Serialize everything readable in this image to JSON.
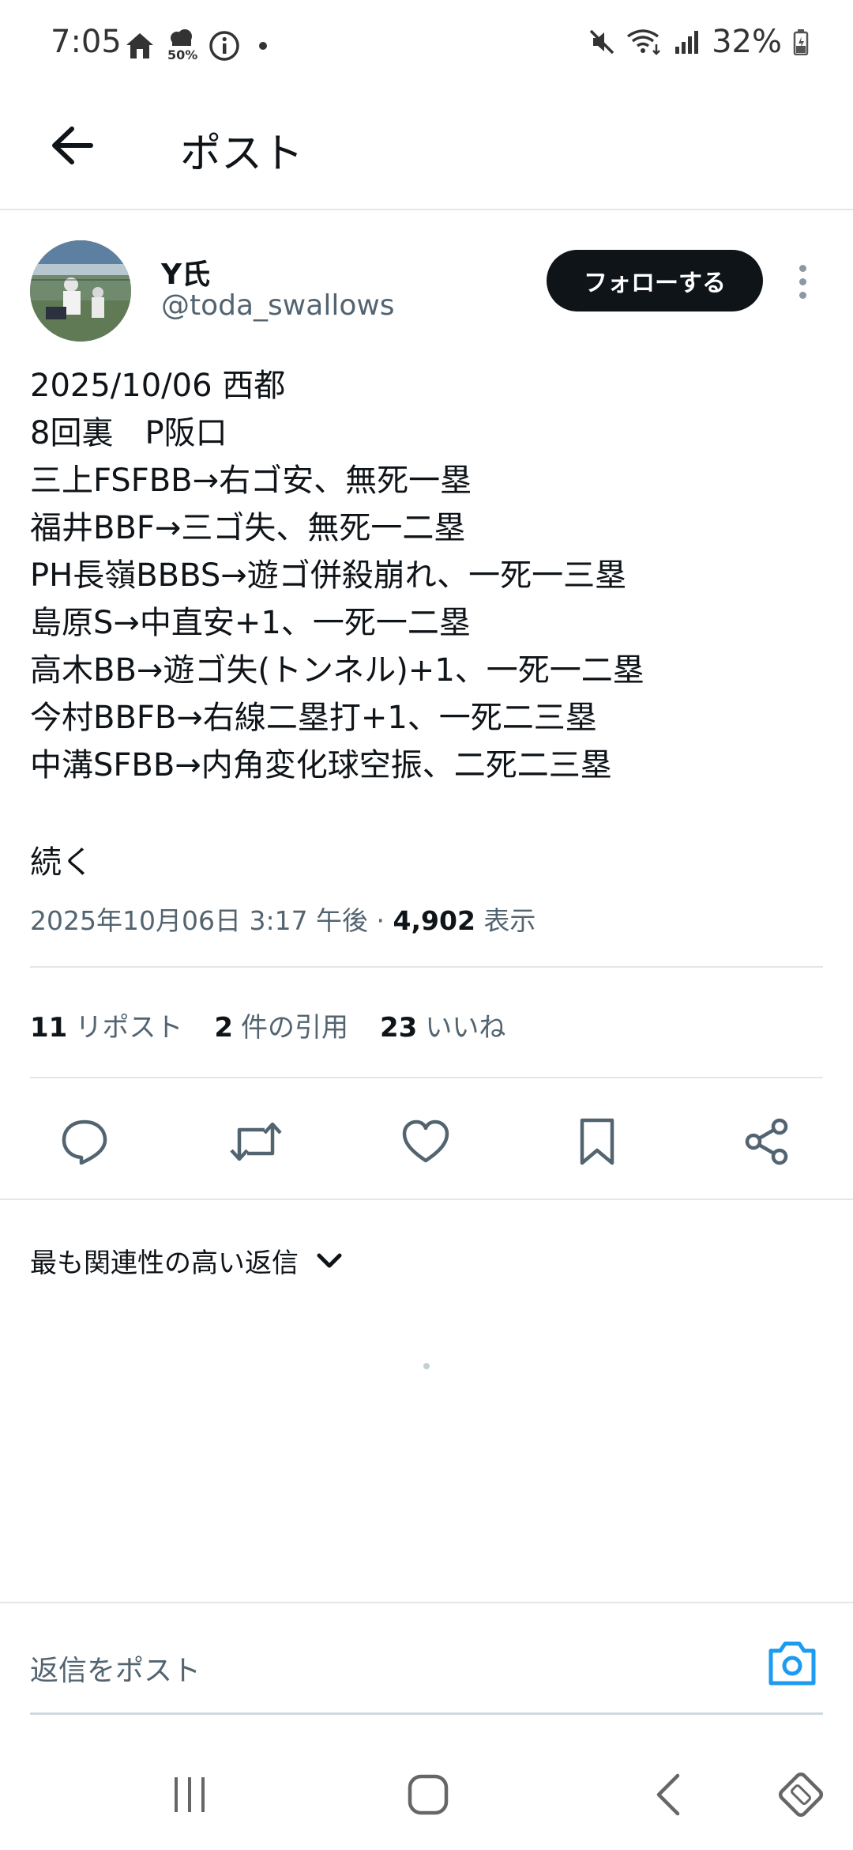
{
  "status_bar": {
    "time": "7:05",
    "battery_percent": "32%",
    "weather_pct": "50%",
    "icons": [
      "home-icon",
      "weather-icon",
      "info-icon",
      "dot-icon",
      "mute-icon",
      "wifi-icon",
      "signal-icon",
      "battery-icon"
    ]
  },
  "header": {
    "title": "ポスト",
    "back_icon": "arrow-left-icon"
  },
  "author": {
    "name": "Y氏",
    "handle": "@toda_swallows",
    "follow_label": "フォローする"
  },
  "post": {
    "lines": [
      "2025/10/06 西都",
      "8回裏　P阪口",
      "三上FSFBB→右ゴ安、無死一塁",
      "福井BBF→三ゴ失、無死一二塁",
      "PH長嶺BBBS→遊ゴ併殺崩れ、一死一三塁",
      "島原S→中直安+1、一死一二塁",
      "高木BB→遊ゴ失(トンネル)+1、一死一二塁",
      "今村BBFB→右線二塁打+1、一死二三塁",
      "中溝SFBB→内角変化球空振、二死二三塁"
    ],
    "continue": "続く",
    "timestamp": "2025年10月06日 3:17 午後 · ",
    "views_count": "4,902",
    "views_label": " 表示"
  },
  "stats": {
    "reposts_count": "11",
    "reposts_label": "リポスト",
    "quotes_count": "2",
    "quotes_label": "件の引用",
    "likes_count": "23",
    "likes_label": "いいね"
  },
  "actions": [
    "reply-icon",
    "repost-icon",
    "like-icon",
    "bookmark-icon",
    "share-icon"
  ],
  "replies": {
    "sort_label": "最も関連性の高い返信"
  },
  "reply_bar": {
    "placeholder": "返信をポスト"
  },
  "colors": {
    "accent": "#1d9bf0",
    "text": "#0f1419",
    "secondary": "#536471",
    "divider": "#e6e6e6"
  }
}
